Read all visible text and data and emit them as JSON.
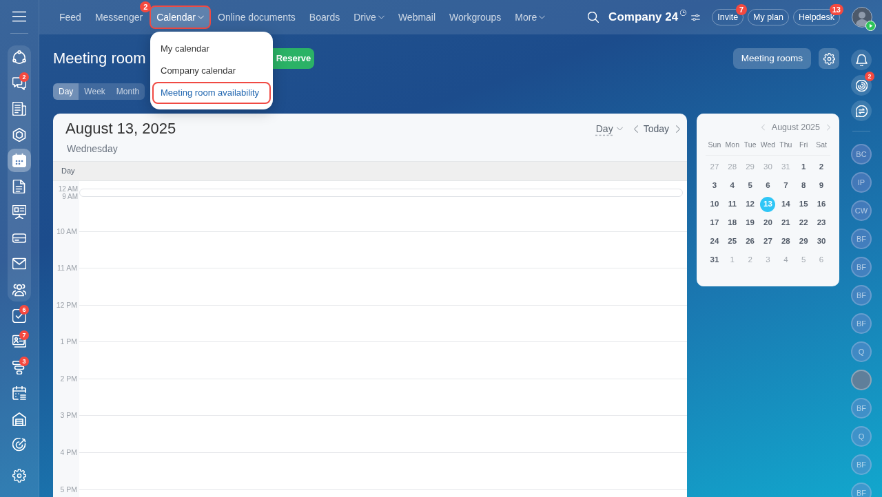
{
  "left_rail": {
    "pinned": [
      {
        "selected": false
      },
      {
        "selected": false,
        "badge": "2"
      },
      {
        "selected": false
      },
      {
        "selected": false
      },
      {
        "selected": true
      },
      {
        "selected": false
      },
      {
        "selected": false
      },
      {
        "selected": false
      },
      {
        "selected": false
      },
      {
        "selected": false
      }
    ],
    "more": [
      {
        "selected": false,
        "badge": "6"
      },
      {
        "selected": false,
        "badge": "7"
      },
      {
        "selected": false,
        "badge": "3"
      },
      {
        "selected": false
      },
      {
        "selected": false
      },
      {
        "selected": false
      }
    ]
  },
  "top_nav": {
    "items": [
      {
        "label": "Feed",
        "selected": false,
        "highlighted": false,
        "has_menu": false
      },
      {
        "label": "Messenger",
        "selected": false,
        "highlighted": false,
        "has_menu": false,
        "badge": "2"
      },
      {
        "label": "Calendar",
        "selected": true,
        "highlighted": true,
        "has_menu": true
      },
      {
        "label": "Online documents",
        "selected": false,
        "highlighted": false,
        "has_menu": false
      },
      {
        "label": "Boards",
        "selected": false,
        "highlighted": false,
        "has_menu": false
      },
      {
        "label": "Drive",
        "selected": false,
        "highlighted": false,
        "has_menu": true
      },
      {
        "label": "Webmail",
        "selected": false,
        "highlighted": false,
        "has_menu": false
      },
      {
        "label": "Workgroups",
        "selected": false,
        "highlighted": false,
        "has_menu": false
      },
      {
        "label": "More",
        "selected": false,
        "highlighted": false,
        "has_menu": true
      }
    ]
  },
  "header": {
    "company": "Company 24",
    "buttons": [
      {
        "label": "Invite",
        "badge": "7"
      },
      {
        "label": "My plan"
      },
      {
        "label": "Helpdesk",
        "badge": "13"
      }
    ]
  },
  "calendar_menu": {
    "items": [
      {
        "label": "My calendar",
        "selected": false,
        "highlighted": false
      },
      {
        "label": "Company calendar",
        "selected": false,
        "highlighted": false
      },
      {
        "label": "Meeting room availability",
        "selected": true,
        "highlighted": true
      }
    ]
  },
  "page": {
    "title": "Meeting room",
    "reserve_button": "Reserve",
    "view_tabs": [
      {
        "label": "Day",
        "selected": true
      },
      {
        "label": "Week",
        "selected": false
      },
      {
        "label": "Month",
        "selected": false
      }
    ],
    "meeting_rooms_button": "Meeting rooms"
  },
  "day_view": {
    "date": "August 13, 2025",
    "weekday": "Wednesday",
    "view_select": "Day",
    "today_button": "Today",
    "section_label": "Day",
    "collapsed_hours": [
      "12 AM",
      "9 AM"
    ],
    "hours": [
      "10 AM",
      "11 AM",
      "12 PM",
      "1 PM",
      "2 PM",
      "3 PM",
      "4 PM",
      "5 PM"
    ]
  },
  "mini_calendar": {
    "month": "August 2025",
    "weekdays": [
      "Sun",
      "Mon",
      "Tue",
      "Wed",
      "Thu",
      "Fri",
      "Sat"
    ],
    "weeks": [
      [
        {
          "day": "27",
          "in_month": false,
          "selected": false
        },
        {
          "day": "28",
          "in_month": false,
          "selected": false
        },
        {
          "day": "29",
          "in_month": false,
          "selected": false
        },
        {
          "day": "30",
          "in_month": false,
          "selected": false
        },
        {
          "day": "31",
          "in_month": false,
          "selected": false
        },
        {
          "day": "1",
          "in_month": true,
          "selected": false
        },
        {
          "day": "2",
          "in_month": true,
          "selected": false
        }
      ],
      [
        {
          "day": "3",
          "in_month": true,
          "selected": false
        },
        {
          "day": "4",
          "in_month": true,
          "selected": false
        },
        {
          "day": "5",
          "in_month": true,
          "selected": false
        },
        {
          "day": "6",
          "in_month": true,
          "selected": false
        },
        {
          "day": "7",
          "in_month": true,
          "selected": false
        },
        {
          "day": "8",
          "in_month": true,
          "selected": false
        },
        {
          "day": "9",
          "in_month": true,
          "selected": false
        }
      ],
      [
        {
          "day": "10",
          "in_month": true,
          "selected": false
        },
        {
          "day": "11",
          "in_month": true,
          "selected": false
        },
        {
          "day": "12",
          "in_month": true,
          "selected": false
        },
        {
          "day": "13",
          "in_month": true,
          "selected": true
        },
        {
          "day": "14",
          "in_month": true,
          "selected": false
        },
        {
          "day": "15",
          "in_month": true,
          "selected": false
        },
        {
          "day": "16",
          "in_month": true,
          "selected": false
        }
      ],
      [
        {
          "day": "17",
          "in_month": true,
          "selected": false
        },
        {
          "day": "18",
          "in_month": true,
          "selected": false
        },
        {
          "day": "19",
          "in_month": true,
          "selected": false
        },
        {
          "day": "20",
          "in_month": true,
          "selected": false
        },
        {
          "day": "21",
          "in_month": true,
          "selected": false
        },
        {
          "day": "22",
          "in_month": true,
          "selected": false
        },
        {
          "day": "23",
          "in_month": true,
          "selected": false
        }
      ],
      [
        {
          "day": "24",
          "in_month": true,
          "selected": false
        },
        {
          "day": "25",
          "in_month": true,
          "selected": false
        },
        {
          "day": "26",
          "in_month": true,
          "selected": false
        },
        {
          "day": "27",
          "in_month": true,
          "selected": false
        },
        {
          "day": "28",
          "in_month": true,
          "selected": false
        },
        {
          "day": "29",
          "in_month": true,
          "selected": false
        },
        {
          "day": "30",
          "in_month": true,
          "selected": false
        }
      ],
      [
        {
          "day": "31",
          "in_month": true,
          "selected": false
        },
        {
          "day": "1",
          "in_month": false,
          "selected": false
        },
        {
          "day": "2",
          "in_month": false,
          "selected": false
        },
        {
          "day": "3",
          "in_month": false,
          "selected": false
        },
        {
          "day": "4",
          "in_month": false,
          "selected": false
        },
        {
          "day": "5",
          "in_month": false,
          "selected": false
        },
        {
          "day": "6",
          "in_month": false,
          "selected": false
        }
      ]
    ]
  },
  "right_rail": {
    "activity_badge": "2",
    "contacts": [
      {
        "kind": "initials",
        "initials": "BC"
      },
      {
        "kind": "initials",
        "initials": "IP"
      },
      {
        "kind": "initials",
        "initials": "CW"
      },
      {
        "kind": "initials",
        "initials": "BF"
      },
      {
        "kind": "initials",
        "initials": "BF"
      },
      {
        "kind": "initials",
        "initials": "BF"
      },
      {
        "kind": "initials",
        "initials": "BF"
      },
      {
        "kind": "initials",
        "initials": "Q"
      },
      {
        "kind": "photo"
      },
      {
        "kind": "initials",
        "initials": "BF"
      },
      {
        "kind": "initials",
        "initials": "Q"
      },
      {
        "kind": "initials",
        "initials": "BF"
      },
      {
        "kind": "initials",
        "initials": "BF"
      }
    ]
  }
}
